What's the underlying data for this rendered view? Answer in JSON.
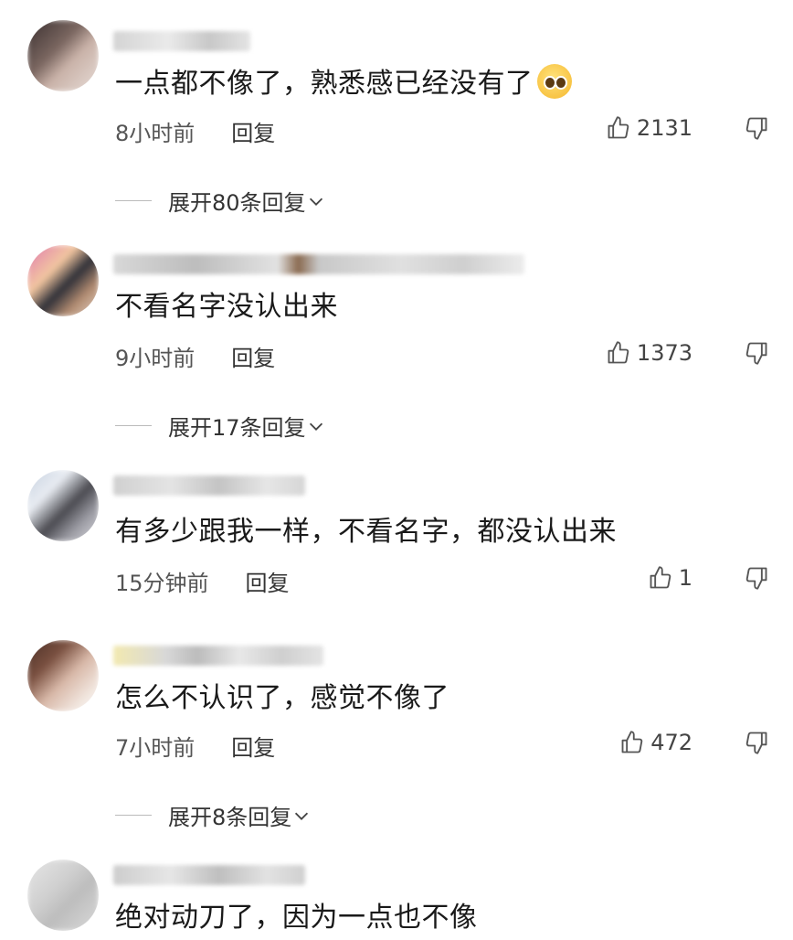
{
  "comments": [
    {
      "text": "一点都不像了，熟悉感已经没有了",
      "has_emoji": true,
      "emoji": "pleading-face",
      "time": "8小时前",
      "reply_label": "回复",
      "likes": "2131",
      "expand_label": "展开80条回复"
    },
    {
      "text": "不看名字没认出来",
      "time": "9小时前",
      "reply_label": "回复",
      "likes": "1373",
      "expand_label": "展开17条回复"
    },
    {
      "text": "有多少跟我一样，不看名字，都没认出来",
      "time": "15分钟前",
      "reply_label": "回复",
      "likes": "1"
    },
    {
      "text": "怎么不认识了，感觉不像了",
      "time": "7小时前",
      "reply_label": "回复",
      "likes": "472",
      "expand_label": "展开8条回复"
    },
    {
      "text": "绝对动刀了，因为一点也不像"
    }
  ],
  "icons": {
    "like": "thumbs-up-icon",
    "dislike": "thumbs-down-icon",
    "expand": "chevron-down-icon"
  }
}
